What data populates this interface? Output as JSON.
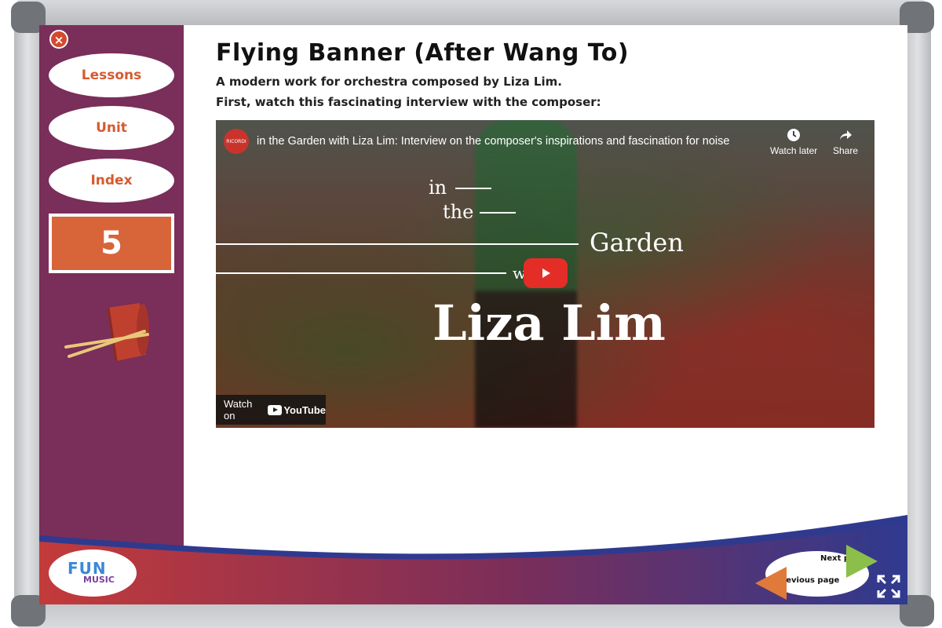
{
  "header": {
    "title": "Flying Banner (After Wang To)",
    "line1": "A modern work for orchestra composed by Liza Lim.",
    "line2": "First, watch this fascinating interview with the composer:"
  },
  "sidebar": {
    "close_symbol": "×",
    "buttons": [
      "Lessons",
      "Unit",
      "Index"
    ],
    "lesson_number": "5"
  },
  "video": {
    "channel": "RICORDI",
    "title": "in the Garden with Liza Lim: Interview on the composer's inspirations and fascination for noise",
    "watch_later": "Watch later",
    "share": "Share",
    "overlay_in": "in",
    "overlay_the": "the",
    "overlay_garden": "Garden",
    "overlay_w": "w",
    "overlay_name": "Liza Lim",
    "watch_on": "Watch on",
    "youtube": "YouTube"
  },
  "footer": {
    "logo_text": "FUN",
    "logo_sub": "MUSIC",
    "next": "Next page",
    "previous": "Previous page"
  },
  "colors": {
    "sidebar": "#7a2e5a",
    "accent": "#d8643a",
    "footer_blue": "#2f3a8f",
    "footer_red": "#c03a3a",
    "next_green": "#8bbf4a",
    "prev_orange": "#e07a3a"
  },
  "icons": [
    "close-icon",
    "bucket-drum-icon",
    "clock-icon",
    "share-icon",
    "play-icon",
    "youtube-icon",
    "next-arrow-icon",
    "previous-arrow-icon",
    "fullscreen-icon"
  ]
}
